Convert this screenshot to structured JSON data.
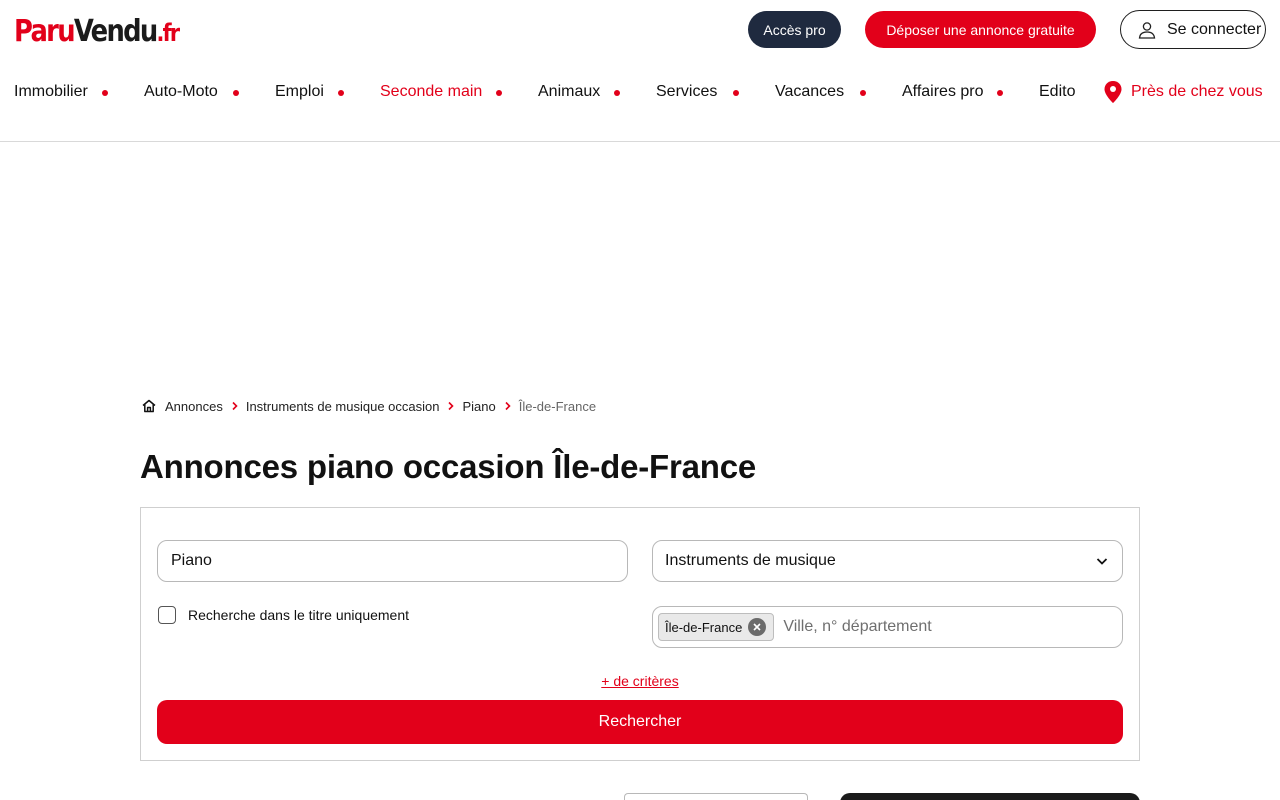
{
  "header": {
    "logo": {
      "part1": "Paru",
      "part2": "Vendu",
      "part3": ".fr"
    },
    "pro_button": "Accès pro",
    "post_button": "Déposer une annonce gratuite",
    "login_button": "Se connecter"
  },
  "nav": {
    "items": [
      {
        "label": "Immobilier",
        "active": false
      },
      {
        "label": "Auto-Moto",
        "active": false
      },
      {
        "label": "Emploi",
        "active": false
      },
      {
        "label": "Seconde main",
        "active": true
      },
      {
        "label": "Animaux",
        "active": false
      },
      {
        "label": "Services",
        "active": false
      },
      {
        "label": "Vacances",
        "active": false
      },
      {
        "label": "Affaires pro",
        "active": false
      },
      {
        "label": "Edito",
        "active": false
      }
    ],
    "near_me": "Près de chez vous"
  },
  "breadcrumb": [
    {
      "label": "Annonces"
    },
    {
      "label": "Instruments de musique occasion"
    },
    {
      "label": "Piano"
    },
    {
      "label": "Île-de-France"
    }
  ],
  "page_title": "Annonces piano occasion Île-de-France",
  "search": {
    "keyword_value": "Piano",
    "category_value": "Instruments de musique",
    "title_only_label": "Recherche dans le titre uniquement",
    "title_only_checked": false,
    "location_tag": "Île-de-France",
    "location_placeholder": "Ville, n° département",
    "more_criteria": "+ de critères",
    "submit": "Rechercher"
  },
  "colors": {
    "brand_red": "#e2001a",
    "navy": "#1f2a3f"
  },
  "icons": {
    "user": "user-icon",
    "pin": "location-pin-icon",
    "home": "home-icon",
    "chevron_right": "chevron-right-icon",
    "chevron_down": "chevron-down-icon",
    "clear": "clear-icon"
  }
}
